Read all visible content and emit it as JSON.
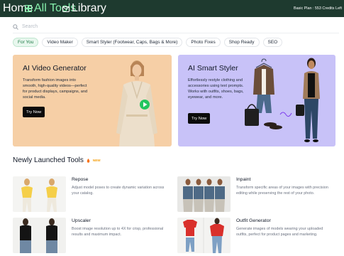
{
  "topbar": {
    "home_label": "Home",
    "all_tools_label": "All Tools",
    "library_label": "Library",
    "plan_text": "Basic Plan : 553 Credits Left"
  },
  "search": {
    "placeholder": "Search"
  },
  "chips": [
    "For You",
    "Video Maker",
    "Smart Styler (Footwear, Caps, Bags & More)",
    "Photo Fixes",
    "Shop Ready",
    "SEO"
  ],
  "banners": {
    "video": {
      "title": "AI Video Generator",
      "desc": "Transform fashion images into smooth, high-quality videos—perfect for product displays, campaigns, and social media.",
      "cta": "Try Now"
    },
    "styler": {
      "title": "AI Smart Styler",
      "desc": "Effortlessly restyle clothing and accessories using text prompts. Works with outfits, shoes, bags, eyewear, and more.",
      "cta": "Try Now"
    }
  },
  "section": {
    "title": "Newly Launched Tools",
    "badge": "NEW"
  },
  "tools": {
    "repose": {
      "name": "Repose",
      "desc": "Adjust model poses to create dynamic variation across your catalog."
    },
    "inpaint": {
      "name": "Inpaint",
      "desc": "Transform specific areas of your images with precision editing while preserving the rest of your photo."
    },
    "upscaler": {
      "name": "Upscaler",
      "desc": "Boost image resolution up to 4X for crisp, professional results and maximum impact."
    },
    "outfit": {
      "name": "Outfit Generator",
      "desc": "Generate images of models wearing your uploaded outfits, perfect for product pages and marketing."
    }
  },
  "colors": {
    "topbar": "#1e3a2f",
    "accent": "#86efac",
    "video_banner": "#f6cfa6",
    "styler_banner": "#c8c2f8",
    "chip_active_bg": "#e8f7ee"
  }
}
